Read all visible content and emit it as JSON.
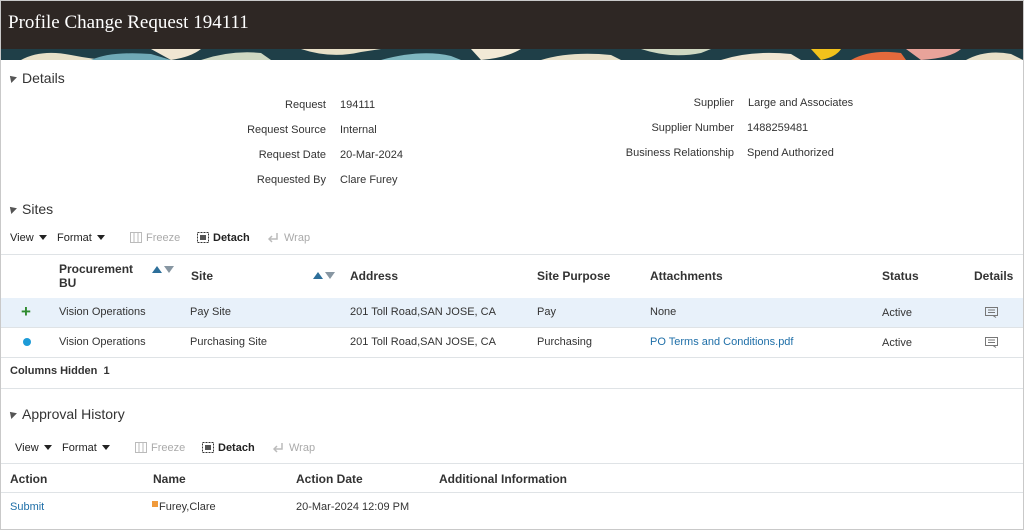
{
  "header": {
    "title": "Profile Change Request 194111"
  },
  "details": {
    "title": "Details",
    "left": [
      {
        "label": "Request",
        "value": "194111"
      },
      {
        "label": "Request Source",
        "value": "Internal"
      },
      {
        "label": "Request Date",
        "value": "20-Mar-2024"
      },
      {
        "label": "Requested By",
        "value": "Clare Furey"
      }
    ],
    "right": [
      {
        "label": "Supplier",
        "value": "Large and Associates"
      },
      {
        "label": "Supplier Number",
        "value": "1488259481"
      },
      {
        "label": "Business Relationship",
        "value": "Spend Authorized"
      }
    ]
  },
  "sites": {
    "title": "Sites",
    "toolbar": {
      "view": "View",
      "format": "Format",
      "freeze": "Freeze",
      "detach": "Detach",
      "wrap": "Wrap"
    },
    "columns": {
      "bu_line1": "Procurement",
      "bu_line2": "BU",
      "site": "Site",
      "address": "Address",
      "purpose": "Site Purpose",
      "attachments": "Attachments",
      "status": "Status",
      "details": "Details"
    },
    "rows": [
      {
        "bu": "Vision Operations",
        "site": "Pay Site",
        "address": "201 Toll Road,SAN JOSE, CA",
        "purpose": "Pay",
        "attachments": "None",
        "status": "Active",
        "marker": "plus-icon"
      },
      {
        "bu": "Vision Operations",
        "site": "Purchasing Site",
        "address": "201 Toll Road,SAN JOSE, CA",
        "purpose": "Purchasing",
        "attachments": "PO Terms and Conditions.pdf",
        "status": "Active",
        "marker": "dot-icon"
      }
    ],
    "columns_hidden_label": "Columns Hidden",
    "columns_hidden_count": "1"
  },
  "approval": {
    "title": "Approval History",
    "toolbar": {
      "view": "View",
      "format": "Format",
      "freeze": "Freeze",
      "detach": "Detach",
      "wrap": "Wrap"
    },
    "columns": {
      "action": "Action",
      "name": "Name",
      "date": "Action Date",
      "info": "Additional Information"
    },
    "rows": [
      {
        "action": "Submit",
        "name": "Furey,Clare",
        "date": "20-Mar-2024 12:09 PM",
        "info": ""
      }
    ]
  },
  "colors": {
    "header_bg": "#2e2724",
    "link": "#1f6fa8",
    "selected_row": "#e8f1fa",
    "add_icon": "#2e8b2e",
    "status_dot": "#1e9bd7"
  }
}
